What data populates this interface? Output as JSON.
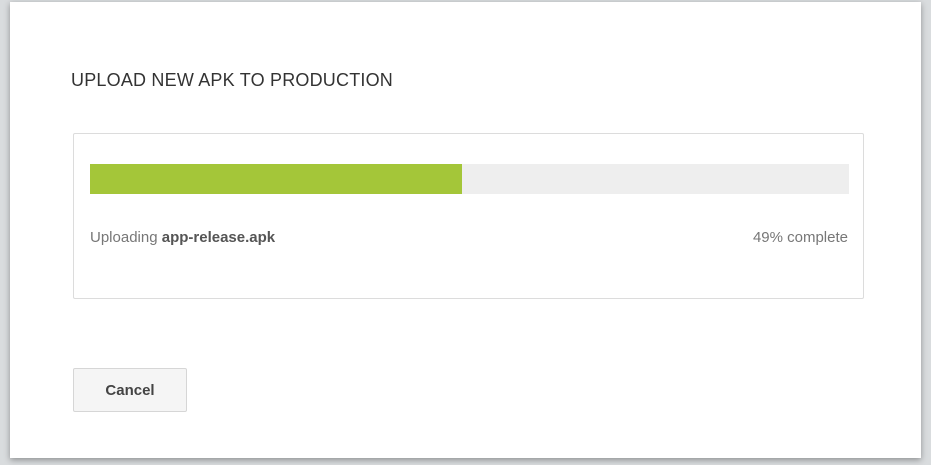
{
  "dialog": {
    "title": "UPLOAD NEW APK TO PRODUCTION",
    "upload": {
      "status_prefix": "Uploading",
      "file_name": "app-release.apk",
      "progress_percent": 49,
      "progress_text": "49% complete",
      "progress_color": "#a4c639",
      "track_color": "#eeeeee"
    },
    "cancel_label": "Cancel"
  }
}
